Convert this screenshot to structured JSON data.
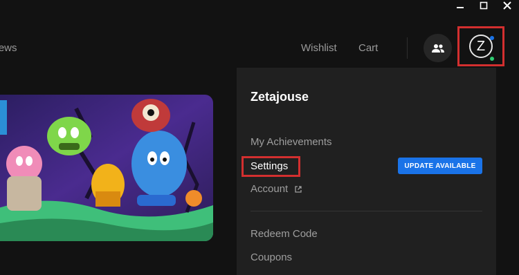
{
  "nav": {
    "news_label": "News",
    "wishlist_label": "Wishlist",
    "cart_label": "Cart"
  },
  "profile": {
    "avatar_initial": "Z",
    "status_dot_colors": [
      "#1a73e8",
      "#2ecc71"
    ]
  },
  "dropdown": {
    "username": "Zetajouse",
    "items": [
      {
        "label": "My Achievements"
      },
      {
        "label": "Settings",
        "badge": "UPDATE AVAILABLE"
      },
      {
        "label": "Account",
        "external": true
      },
      {
        "label": "Redeem Code"
      },
      {
        "label": "Coupons"
      }
    ]
  },
  "colors": {
    "background": "#121212",
    "dropdown_bg": "#202020",
    "accent_blue": "#1a73e8",
    "highlight_red": "#d32f2f"
  }
}
